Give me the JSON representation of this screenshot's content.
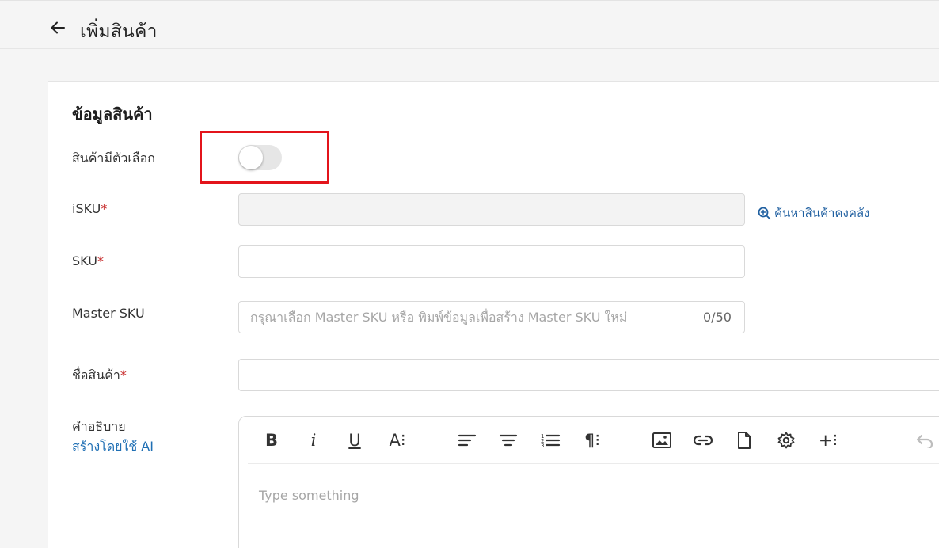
{
  "header": {
    "title": "เพิ่มสินค้า",
    "back_icon": "arrow-left-icon"
  },
  "section": {
    "title": "ข้อมูลสินค้า"
  },
  "fields": {
    "has_variants": {
      "label": "สินค้ามีตัวเลือก",
      "enabled": false
    },
    "isku": {
      "label": "iSKU",
      "required_mark": "*",
      "value": "",
      "disabled": true
    },
    "search_inventory_link": "ค้นหาสินค้าคงคลัง",
    "sku": {
      "label": "SKU",
      "required_mark": "*",
      "value": ""
    },
    "master_sku": {
      "label": "Master SKU",
      "placeholder": "กรุณาเลือก Master SKU หรือ พิมพ์ข้อมูลเพื่อสร้าง Master SKU ใหม่",
      "counter": "0/50"
    },
    "product_name": {
      "label": "ชื่อสินค้า",
      "required_mark": "*",
      "value": ""
    },
    "description": {
      "label": "คำอธิบาย",
      "ai_link": "สร้างโดยใช้ AI",
      "placeholder": "Type something"
    }
  },
  "editor_toolbar": {
    "bold": "B",
    "italic": "i",
    "underline": "U",
    "font_size": "A⁝",
    "paragraph": "¶⁝",
    "insert_more": "+⁝"
  },
  "colors": {
    "highlight": "#e3141b",
    "link": "#1f5fa0",
    "required": "#c62828"
  }
}
